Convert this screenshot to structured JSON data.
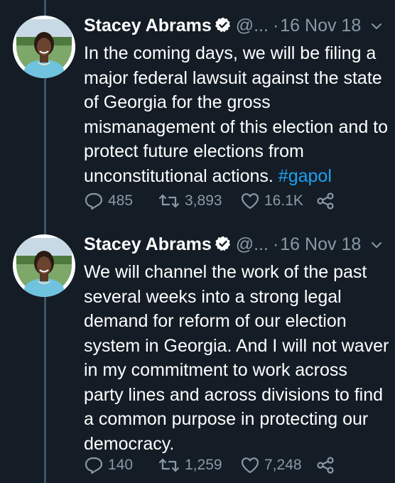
{
  "tweets": [
    {
      "author": {
        "name": "Stacey Abrams",
        "handle": "@...",
        "verified": true,
        "avatar": "profile-photo"
      },
      "separator": "·",
      "timestamp": "16 Nov 18",
      "menu_icon": "chevron-down-icon",
      "text": "In the coming days, we will be filing a major federal lawsuit against the state of Georgia for the gross mismanagement of this election and to protect future elections from unconstitutional actions.",
      "hashtag": "#gapol",
      "stats": {
        "replies": "485",
        "retweets": "3,893",
        "likes": "16.1K"
      }
    },
    {
      "author": {
        "name": "Stacey Abrams",
        "handle": "@...",
        "verified": true,
        "avatar": "profile-photo"
      },
      "separator": "·",
      "timestamp": "16 Nov 18",
      "menu_icon": "chevron-down-icon",
      "text": "We will channel the work of the past several weeks into a strong legal demand for reform of our election system in Georgia. And I will not waver in my commitment to work across party lines and across divisions to find a common purpose in protecting our democracy.",
      "hashtag": "",
      "stats": {
        "replies": "140",
        "retweets": "1,259",
        "likes": "7,248"
      }
    }
  ],
  "colors": {
    "background": "#141d26",
    "text": "#ffffff",
    "secondary": "#8899a6",
    "link": "#1da1f2",
    "verified": "#ffffff",
    "thread_line": "#3d5466"
  }
}
